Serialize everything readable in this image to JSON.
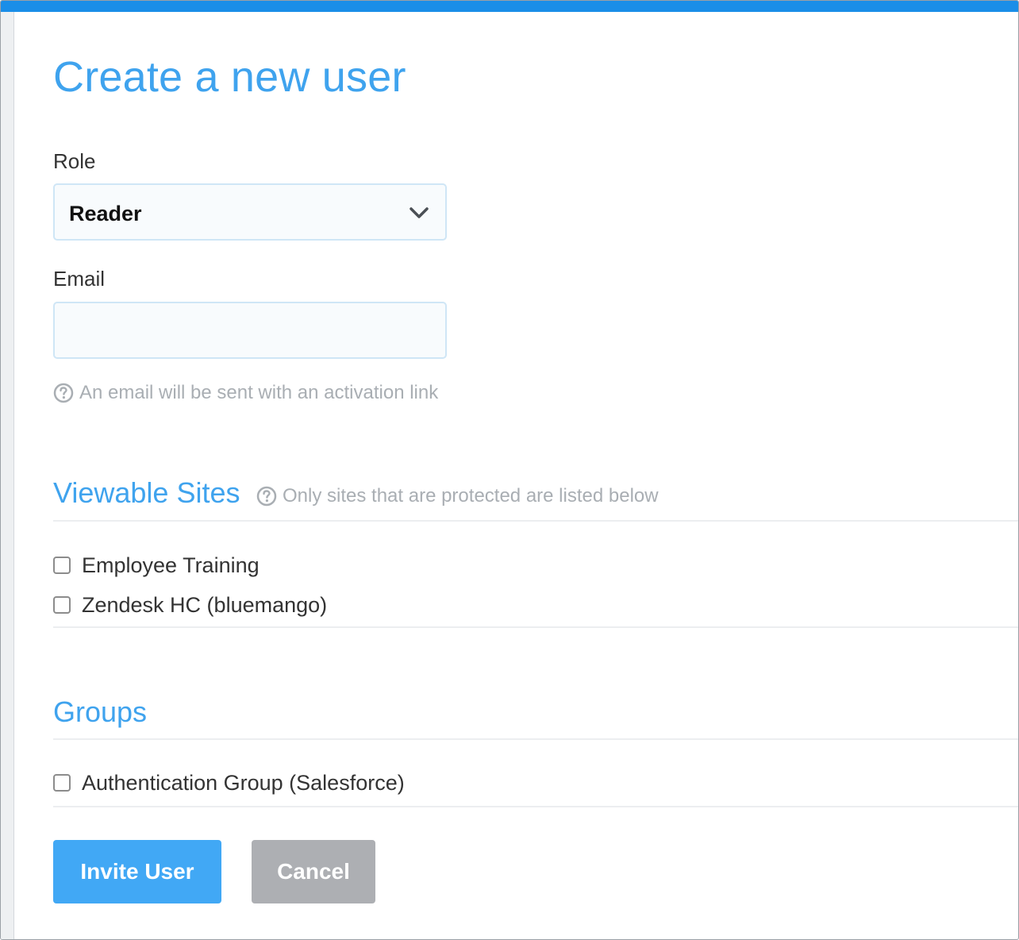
{
  "page": {
    "title": "Create a new user"
  },
  "role": {
    "label": "Role",
    "selected": "Reader"
  },
  "email": {
    "label": "Email",
    "value": "",
    "placeholder": "",
    "help": "An email will be sent with an activation link"
  },
  "viewable_sites": {
    "title": "Viewable Sites",
    "help": "Only sites that are protected are listed below",
    "items": [
      {
        "label": "Employee Training",
        "checked": false
      },
      {
        "label": "Zendesk HC (bluemango)",
        "checked": false
      }
    ]
  },
  "groups": {
    "title": "Groups",
    "items": [
      {
        "label": "Authentication Group (Salesforce)",
        "checked": false
      }
    ]
  },
  "actions": {
    "invite_label": "Invite User",
    "cancel_label": "Cancel"
  },
  "colors": {
    "accent": "#3fa3ee",
    "top_bar": "#1a8ee8",
    "primary_button": "#41a8f5",
    "secondary_button": "#adafb3",
    "muted_text": "#a9aeb3"
  },
  "icons": {
    "select": "chevron-down-icon",
    "help": "question-circle-icon"
  }
}
